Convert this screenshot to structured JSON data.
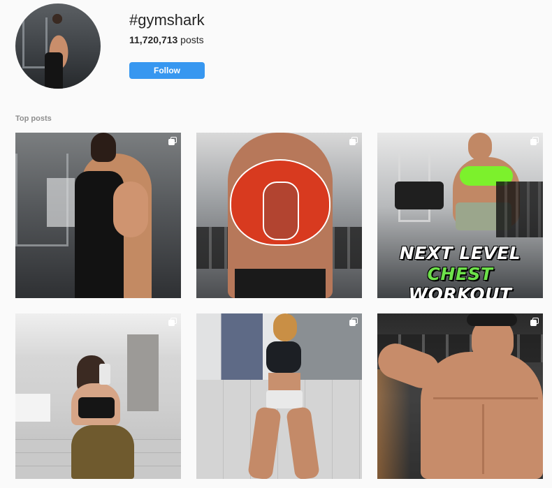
{
  "header": {
    "title": "#gymshark",
    "post_count": "11,720,713",
    "post_suffix": " posts",
    "follow_label": "Follow"
  },
  "section": {
    "label": "Top posts"
  },
  "posts": [
    {
      "row": 1,
      "col": 1,
      "multi": true
    },
    {
      "row": 1,
      "col": 2,
      "multi": true
    },
    {
      "row": 1,
      "col": 3,
      "multi": true,
      "overlay_line1": "NEXT LEVEL",
      "overlay_line2_accent": "CHEST",
      "overlay_line2_rest": " WORKOUT"
    },
    {
      "row": 2,
      "col": 1,
      "multi": true
    },
    {
      "row": 2,
      "col": 2,
      "multi": true
    },
    {
      "row": 2,
      "col": 3,
      "multi": true
    }
  ],
  "colors": {
    "accent": "#3797f0",
    "overlay_green": "#6de14a",
    "muscle_red": "#d83a1f"
  },
  "icons": [
    "multiple-posts-icon"
  ]
}
